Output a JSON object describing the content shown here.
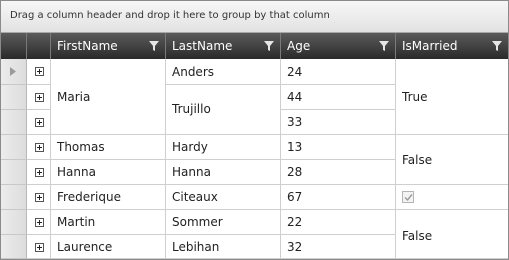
{
  "group_panel": {
    "hint": "Drag a column header and drop it here to group by that column"
  },
  "columns": [
    "FirstName",
    "LastName",
    "Age",
    "IsMarried"
  ],
  "icons": {
    "filter": "funnel-filter-icon",
    "row_indicator": "current-row-arrow-icon",
    "expand": "plus-expander-icon"
  },
  "rows": [
    {
      "first": "Maria",
      "last": "Anders",
      "age": "24",
      "married": "True"
    },
    {
      "first": "Maria",
      "last": "Trujillo",
      "age": "44",
      "married": "True"
    },
    {
      "first": "Maria",
      "last": "Trujillo",
      "age": "33",
      "married": "True"
    },
    {
      "first": "Thomas",
      "last": "Hardy",
      "age": "13",
      "married": "False"
    },
    {
      "first": "Hanna",
      "last": "Hanna",
      "age": "28",
      "married": "False"
    },
    {
      "first": "Frederique",
      "last": "Citeaux",
      "age": "67",
      "married": true
    },
    {
      "first": "Martin",
      "last": "Sommer",
      "age": "22",
      "married": "False"
    },
    {
      "first": "Laurence",
      "last": "Lebihan",
      "age": "32",
      "married": "False"
    }
  ],
  "merged": {
    "maria": "Maria",
    "trujillo": "Trujillo",
    "true_group": "True",
    "false_group_1": "False",
    "false_group_2": "False"
  }
}
